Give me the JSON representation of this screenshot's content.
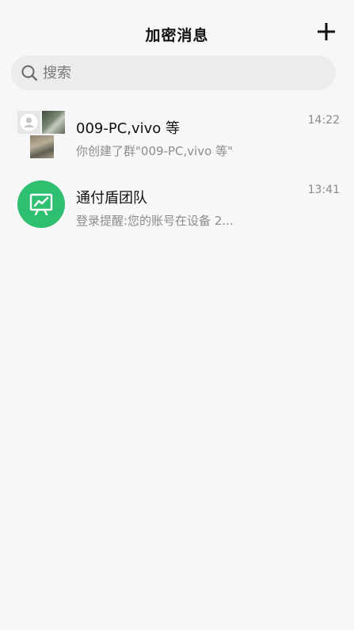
{
  "header": {
    "title": "加密消息"
  },
  "search": {
    "placeholder": "搜索"
  },
  "chats": [
    {
      "name": "009-PC,vivo 等",
      "preview": "你创建了群\"009-PC,vivo 等\"",
      "time": "14:22",
      "avatar": "group-photo-collage"
    },
    {
      "name": "通付盾团队",
      "preview": "登录提醒:您的账号在设备 2...",
      "time": "13:41",
      "avatar": "chart-presentation-icon",
      "avatar_color": "#2fbf71"
    }
  ],
  "colors": {
    "background": "#f7f7f9",
    "search_bg": "#ececee",
    "accent_green": "#2fbf71",
    "secondary_text": "#8c8c8c"
  }
}
